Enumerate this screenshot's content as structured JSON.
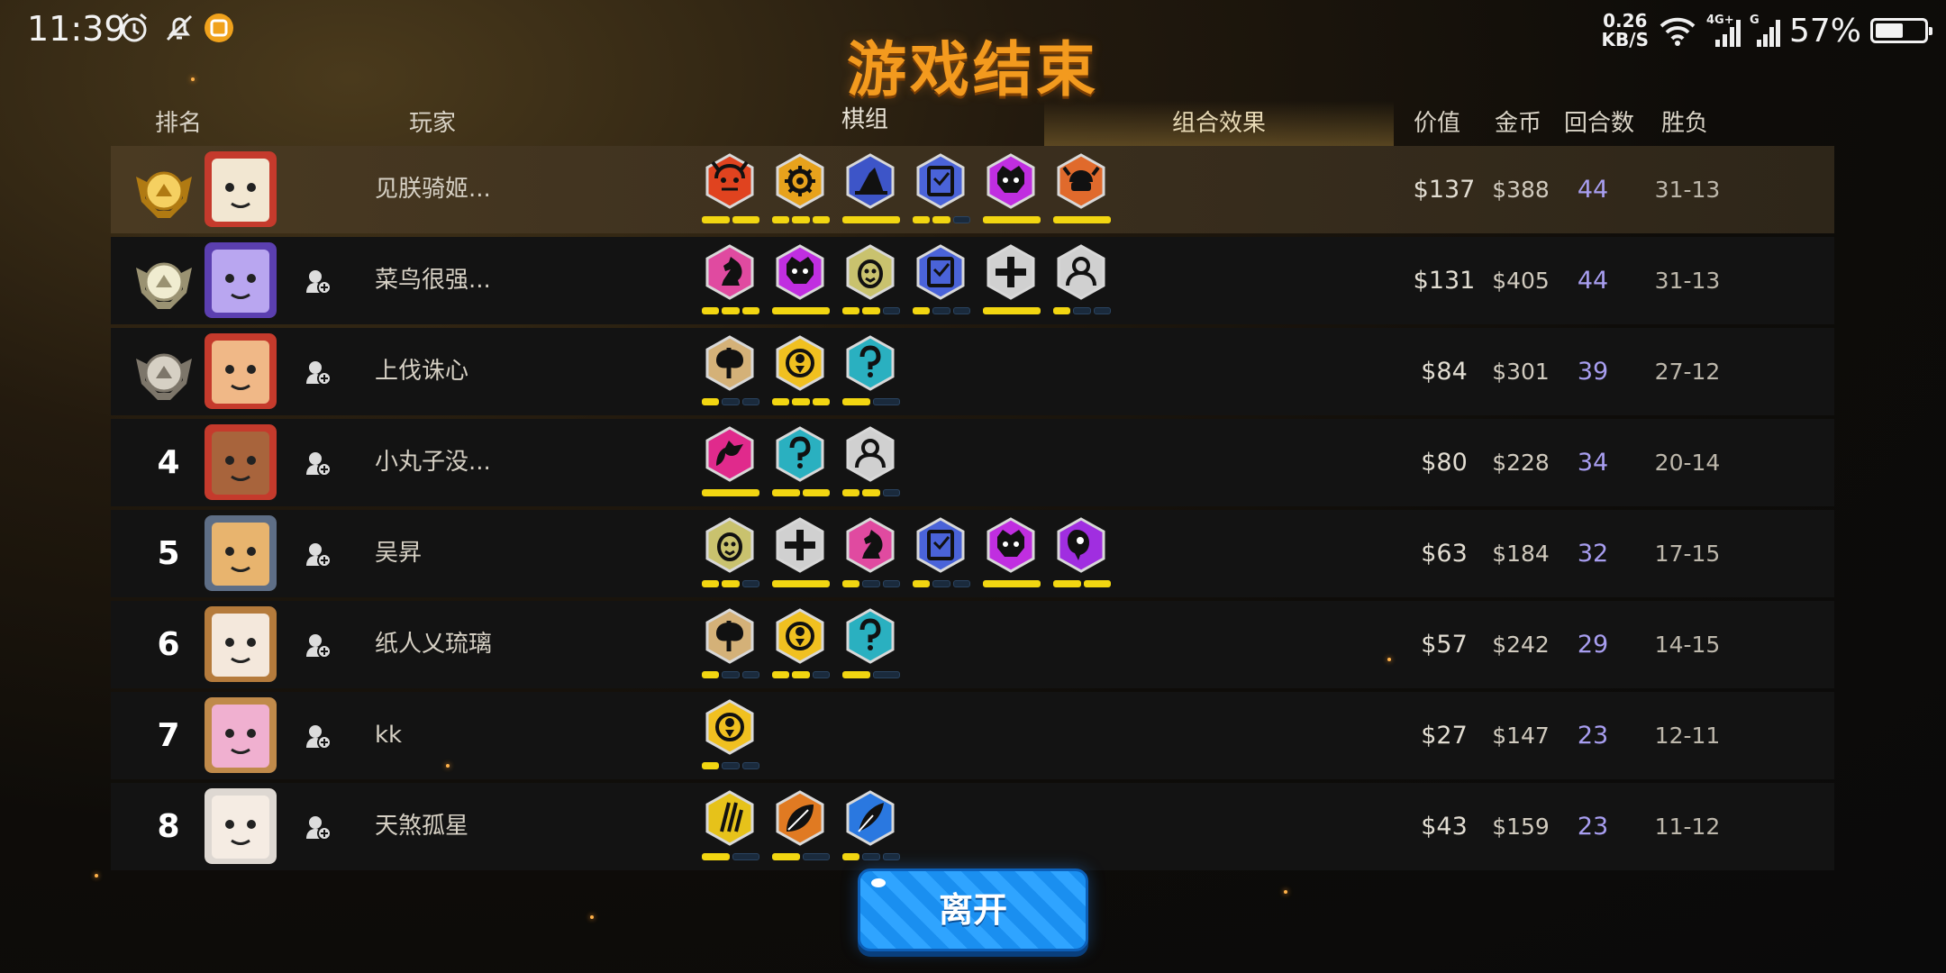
{
  "status_bar": {
    "time": "11:39",
    "net_speed_value": "0.26",
    "net_speed_unit": "KB/S",
    "battery_percent": "57%",
    "battery_level": 0.57,
    "icons": [
      "alarm-icon",
      "mute-notification-icon",
      "app-notification-icon",
      "wifi-icon",
      "signal-4g-icon",
      "signal-g-icon",
      "battery-icon"
    ]
  },
  "title": "游戏结束",
  "columns": {
    "rank": "排名",
    "player": "玩家",
    "pieces_tab": "棋组",
    "synergy_tab": "组合效果",
    "value": "价值",
    "gold": "金币",
    "rounds": "回合数",
    "win_loss": "胜负"
  },
  "leave_button": "离开",
  "colors": {
    "title": "#f39a1e",
    "pip_active": "#f2d611",
    "rounds_text": "#a89ef0",
    "leave_button": "#1a8ff0"
  },
  "players": [
    {
      "rank": "1",
      "badge": "gold",
      "name": "见朕骑姬...",
      "avatar": "skull-avatar",
      "traits": [
        {
          "icon": "demon-icon",
          "color": "#e0431f",
          "pips": [
            1,
            1
          ]
        },
        {
          "icon": "gear-icon",
          "color": "#e7a21c",
          "pips": [
            1,
            1,
            1
          ]
        },
        {
          "icon": "wizard-hat-icon",
          "color": "#3d55c8",
          "pips": [
            1
          ]
        },
        {
          "icon": "spellbook-icon",
          "color": "#4a63d8",
          "pips": [
            1,
            1,
            0
          ]
        },
        {
          "icon": "beast-face-icon",
          "color": "#c02ee0",
          "pips": [
            1
          ]
        },
        {
          "icon": "viking-icon",
          "color": "#e06a2c",
          "pips": [
            1
          ]
        }
      ],
      "value": "$137",
      "gold": "$388",
      "rounds": "44",
      "wl": "31-13"
    },
    {
      "rank": "2",
      "badge": "silver",
      "name": "菜鸟很强...",
      "avatar": "purple-knight-avatar",
      "traits": [
        {
          "icon": "knight-icon",
          "color": "#e04aa0",
          "pips": [
            1,
            1,
            1
          ]
        },
        {
          "icon": "beast-face-icon",
          "color": "#c02ee0",
          "pips": [
            1
          ]
        },
        {
          "icon": "egg-icon",
          "color": "#c9c26e",
          "pips": [
            1,
            1,
            0
          ]
        },
        {
          "icon": "spellbook-icon",
          "color": "#4a63d8",
          "pips": [
            1,
            0,
            0
          ]
        },
        {
          "icon": "cross-icon",
          "color": "#d0d0d0",
          "pips": [
            1
          ]
        },
        {
          "icon": "person-icon",
          "color": "#d0d0d0",
          "pips": [
            1,
            0,
            0
          ]
        }
      ],
      "value": "$131",
      "gold": "$405",
      "rounds": "44",
      "wl": "31-13"
    },
    {
      "rank": "3",
      "badge": "bronze",
      "name": "上伐诛心",
      "avatar": "hero-red-frame-avatar",
      "traits": [
        {
          "icon": "axe-icon",
          "color": "#d4b178",
          "pips": [
            1,
            0,
            0
          ]
        },
        {
          "icon": "ghost-icon",
          "color": "#f0c020",
          "pips": [
            1,
            1,
            1
          ]
        },
        {
          "icon": "assassin-icon",
          "color": "#2ab0c0",
          "pips": [
            1,
            0
          ]
        }
      ],
      "value": "$84",
      "gold": "$301",
      "rounds": "39",
      "wl": "27-12"
    },
    {
      "rank": "4",
      "badge": "",
      "name": "小丸子没...",
      "avatar": "girl-red-frame-avatar",
      "traits": [
        {
          "icon": "dragon-icon",
          "color": "#e02a8c",
          "pips": [
            1
          ]
        },
        {
          "icon": "assassin-icon",
          "color": "#2ab0c0",
          "pips": [
            1,
            1
          ]
        },
        {
          "icon": "person-icon",
          "color": "#d0d0d0",
          "pips": [
            1,
            1,
            0
          ]
        }
      ],
      "value": "$80",
      "gold": "$228",
      "rounds": "34",
      "wl": "20-14"
    },
    {
      "rank": "5",
      "badge": "",
      "name": "吴昇",
      "avatar": "blond-boy-avatar",
      "traits": [
        {
          "icon": "egg-icon",
          "color": "#c9c26e",
          "pips": [
            1,
            1,
            0
          ]
        },
        {
          "icon": "cross-icon",
          "color": "#d0d0d0",
          "pips": [
            1
          ]
        },
        {
          "icon": "knight-icon",
          "color": "#e04aa0",
          "pips": [
            1,
            0,
            0
          ]
        },
        {
          "icon": "spellbook-icon",
          "color": "#4a63d8",
          "pips": [
            1,
            0,
            0
          ]
        },
        {
          "icon": "beast-face-icon",
          "color": "#c02ee0",
          "pips": [
            1
          ]
        },
        {
          "icon": "demon-hand-icon",
          "color": "#a02ee0",
          "pips": [
            1,
            1
          ]
        }
      ],
      "value": "$63",
      "gold": "$184",
      "rounds": "32",
      "wl": "17-15"
    },
    {
      "rank": "6",
      "badge": "",
      "name": "纸人乂琉璃",
      "avatar": "girl-rose-frame-avatar",
      "traits": [
        {
          "icon": "axe-icon",
          "color": "#d4b178",
          "pips": [
            1,
            0,
            0
          ]
        },
        {
          "icon": "ghost-icon",
          "color": "#f0c020",
          "pips": [
            1,
            1,
            0
          ]
        },
        {
          "icon": "assassin-icon",
          "color": "#2ab0c0",
          "pips": [
            1,
            0
          ]
        }
      ],
      "value": "$57",
      "gold": "$242",
      "rounds": "29",
      "wl": "14-15"
    },
    {
      "rank": "7",
      "badge": "",
      "name": "kk",
      "avatar": "sunglasses-avatar",
      "traits": [
        {
          "icon": "ghost-icon",
          "color": "#f0c020",
          "pips": [
            1,
            0,
            0
          ]
        }
      ],
      "value": "$27",
      "gold": "$147",
      "rounds": "23",
      "wl": "12-11"
    },
    {
      "rank": "8",
      "badge": "",
      "name": "天煞孤星",
      "avatar": "white-hair-girl-avatar",
      "traits": [
        {
          "icon": "claw-icon",
          "color": "#e6c21a",
          "pips": [
            1,
            0
          ]
        },
        {
          "icon": "leaf-icon",
          "color": "#e07a22",
          "pips": [
            1,
            0
          ]
        },
        {
          "icon": "feather-icon",
          "color": "#2a78e0",
          "pips": [
            1,
            0,
            0
          ]
        }
      ],
      "value": "$43",
      "gold": "$159",
      "rounds": "23",
      "wl": "11-12"
    }
  ]
}
